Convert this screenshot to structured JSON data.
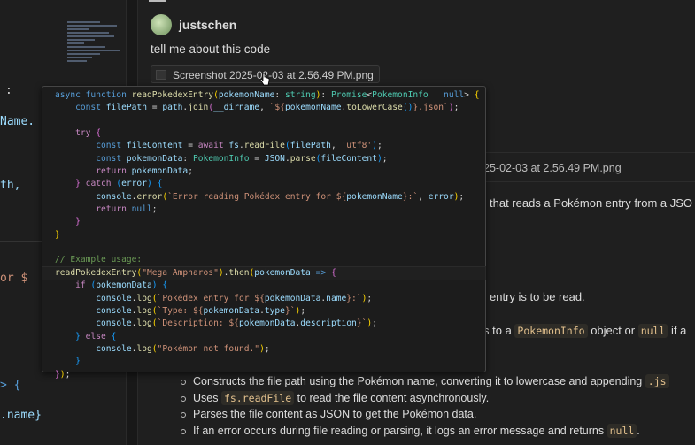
{
  "editor": {
    "fragments": [
      ":",
      "Name.",
      "th,",
      "or $",
      "> {",
      ".name}"
    ]
  },
  "chat": {
    "user": {
      "name": "justschen",
      "message": "tell me about this code"
    },
    "attachment": "Screenshot 2025-02-03 at 2.56.49 PM.png",
    "response_attachment": "25-02-03 at 2.56.49 PM.png",
    "response": {
      "intro": "that reads a Pokémon entry from a JSO",
      "param": "entry is to be read.",
      "returns_pre": "s to a ",
      "returns_code1": "PokemonInfo",
      "returns_mid": " object or ",
      "returns_code2": "null",
      "returns_post": " if a",
      "bullets": [
        {
          "pre": "Constructs the file path using the Pokémon name, converting it to lowercase and appending ",
          "code": ".js",
          "post": ""
        },
        {
          "pre": "Uses ",
          "code": "fs.readFile",
          "post": " to read the file content asynchronously."
        },
        {
          "pre": "Parses the file content as JSON to get the Pokémon data.",
          "code": "",
          "post": ""
        },
        {
          "pre": "If an error occurs during file reading or parsing, it logs an error message and returns ",
          "code": "null",
          "post": "."
        }
      ]
    }
  },
  "code_popup": {
    "lines": [
      [
        [
          "kw",
          "async "
        ],
        [
          "kw",
          "function "
        ],
        [
          "fn",
          "readPokedexEntry"
        ],
        [
          "br",
          "("
        ],
        [
          "var",
          "pokemonName"
        ],
        [
          "p",
          ": "
        ],
        [
          "ty",
          "string"
        ],
        [
          "br",
          ")"
        ],
        [
          "p",
          ": "
        ],
        [
          "ty",
          "Promise"
        ],
        [
          "p",
          "<"
        ],
        [
          "ty",
          "PokemonInfo"
        ],
        [
          "p",
          " | "
        ],
        [
          "kw",
          "null"
        ],
        [
          "p",
          "> "
        ],
        [
          "br",
          "{"
        ]
      ],
      [
        [
          "p",
          "    "
        ],
        [
          "kw",
          "const "
        ],
        [
          "var",
          "filePath"
        ],
        [
          "p",
          " = "
        ],
        [
          "var",
          "path"
        ],
        [
          "p",
          "."
        ],
        [
          "fn",
          "join"
        ],
        [
          "br2",
          "("
        ],
        [
          "var",
          "__dirname"
        ],
        [
          "p",
          ", "
        ],
        [
          "str",
          "`${"
        ],
        [
          "var",
          "pokemonName"
        ],
        [
          "p",
          "."
        ],
        [
          "fn",
          "toLowerCase"
        ],
        [
          "br3",
          "()"
        ],
        [
          "str",
          "}.json`"
        ],
        [
          "br2",
          ")"
        ],
        [
          "p",
          ";"
        ]
      ],
      [],
      [
        [
          "p",
          "    "
        ],
        [
          "ctl",
          "try "
        ],
        [
          "br2",
          "{"
        ]
      ],
      [
        [
          "p",
          "        "
        ],
        [
          "kw",
          "const "
        ],
        [
          "var",
          "fileContent"
        ],
        [
          "p",
          " = "
        ],
        [
          "ctl",
          "await "
        ],
        [
          "var",
          "fs"
        ],
        [
          "p",
          "."
        ],
        [
          "fn",
          "readFile"
        ],
        [
          "br3",
          "("
        ],
        [
          "var",
          "filePath"
        ],
        [
          "p",
          ", "
        ],
        [
          "str",
          "'utf8'"
        ],
        [
          "br3",
          ")"
        ],
        [
          "p",
          ";"
        ]
      ],
      [
        [
          "p",
          "        "
        ],
        [
          "kw",
          "const "
        ],
        [
          "var",
          "pokemonData"
        ],
        [
          "p",
          ": "
        ],
        [
          "ty",
          "PokemonInfo"
        ],
        [
          "p",
          " = "
        ],
        [
          "var",
          "JSON"
        ],
        [
          "p",
          "."
        ],
        [
          "fn",
          "parse"
        ],
        [
          "br3",
          "("
        ],
        [
          "var",
          "fileContent"
        ],
        [
          "br3",
          ")"
        ],
        [
          "p",
          ";"
        ]
      ],
      [
        [
          "p",
          "        "
        ],
        [
          "ctl",
          "return "
        ],
        [
          "var",
          "pokemonData"
        ],
        [
          "p",
          ";"
        ]
      ],
      [
        [
          "p",
          "    "
        ],
        [
          "br2",
          "}"
        ],
        [
          "ctl",
          " catch "
        ],
        [
          "br3",
          "("
        ],
        [
          "var",
          "error"
        ],
        [
          "br3",
          ")"
        ],
        [
          "p",
          " "
        ],
        [
          "br3",
          "{"
        ]
      ],
      [
        [
          "p",
          "        "
        ],
        [
          "var",
          "console"
        ],
        [
          "p",
          "."
        ],
        [
          "fn",
          "error"
        ],
        [
          "br",
          "("
        ],
        [
          "str",
          "`Error reading Pokédex entry for ${"
        ],
        [
          "var",
          "pokemonName"
        ],
        [
          "str",
          "}:`"
        ],
        [
          "p",
          ", "
        ],
        [
          "var",
          "error"
        ],
        [
          "br",
          ")"
        ],
        [
          "p",
          ";"
        ]
      ],
      [
        [
          "p",
          "        "
        ],
        [
          "ctl",
          "return "
        ],
        [
          "kw",
          "null"
        ],
        [
          "p",
          ";"
        ]
      ],
      [
        [
          "p",
          "    "
        ],
        [
          "br2",
          "}"
        ]
      ],
      [
        [
          "br",
          "}"
        ]
      ],
      [],
      [
        [
          "cm",
          "// Example usage:"
        ]
      ],
      [
        [
          "fn",
          "readPokedexEntry"
        ],
        [
          "br",
          "("
        ],
        [
          "str",
          "\"Mega Ampharos\""
        ],
        [
          "br",
          ")"
        ],
        [
          "p",
          "."
        ],
        [
          "fn",
          "then"
        ],
        [
          "br",
          "("
        ],
        [
          "var",
          "pokemonData"
        ],
        [
          "kw",
          " => "
        ],
        [
          "br2",
          "{"
        ]
      ],
      [
        [
          "p",
          "    "
        ],
        [
          "ctl",
          "if "
        ],
        [
          "br3",
          "("
        ],
        [
          "var",
          "pokemonData"
        ],
        [
          "br3",
          ")"
        ],
        [
          "p",
          " "
        ],
        [
          "br3",
          "{"
        ]
      ],
      [
        [
          "p",
          "        "
        ],
        [
          "var",
          "console"
        ],
        [
          "p",
          "."
        ],
        [
          "fn",
          "log"
        ],
        [
          "br",
          "("
        ],
        [
          "str",
          "`Pokédex entry for ${"
        ],
        [
          "var",
          "pokemonData"
        ],
        [
          "p",
          "."
        ],
        [
          "var",
          "name"
        ],
        [
          "str",
          "}:`"
        ],
        [
          "br",
          ")"
        ],
        [
          "p",
          ";"
        ]
      ],
      [
        [
          "p",
          "        "
        ],
        [
          "var",
          "console"
        ],
        [
          "p",
          "."
        ],
        [
          "fn",
          "log"
        ],
        [
          "br",
          "("
        ],
        [
          "str",
          "`Type: ${"
        ],
        [
          "var",
          "pokemonData"
        ],
        [
          "p",
          "."
        ],
        [
          "var",
          "type"
        ],
        [
          "str",
          "}`"
        ],
        [
          "br",
          ")"
        ],
        [
          "p",
          ";"
        ]
      ],
      [
        [
          "p",
          "        "
        ],
        [
          "var",
          "console"
        ],
        [
          "p",
          "."
        ],
        [
          "fn",
          "log"
        ],
        [
          "br",
          "("
        ],
        [
          "str",
          "`Description: ${"
        ],
        [
          "var",
          "pokemonData"
        ],
        [
          "p",
          "."
        ],
        [
          "var",
          "description"
        ],
        [
          "str",
          "}`"
        ],
        [
          "br",
          ")"
        ],
        [
          "p",
          ";"
        ]
      ],
      [
        [
          "p",
          "    "
        ],
        [
          "br3",
          "}"
        ],
        [
          "ctl",
          " else "
        ],
        [
          "br3",
          "{"
        ]
      ],
      [
        [
          "p",
          "        "
        ],
        [
          "var",
          "console"
        ],
        [
          "p",
          "."
        ],
        [
          "fn",
          "log"
        ],
        [
          "br",
          "("
        ],
        [
          "str",
          "\"Pokémon not found.\""
        ],
        [
          "br",
          ")"
        ],
        [
          "p",
          ";"
        ]
      ],
      [
        [
          "p",
          "    "
        ],
        [
          "br3",
          "}"
        ]
      ],
      [
        [
          "br2",
          "}"
        ],
        [
          "br",
          ")"
        ],
        [
          "p",
          ";"
        ]
      ]
    ]
  }
}
